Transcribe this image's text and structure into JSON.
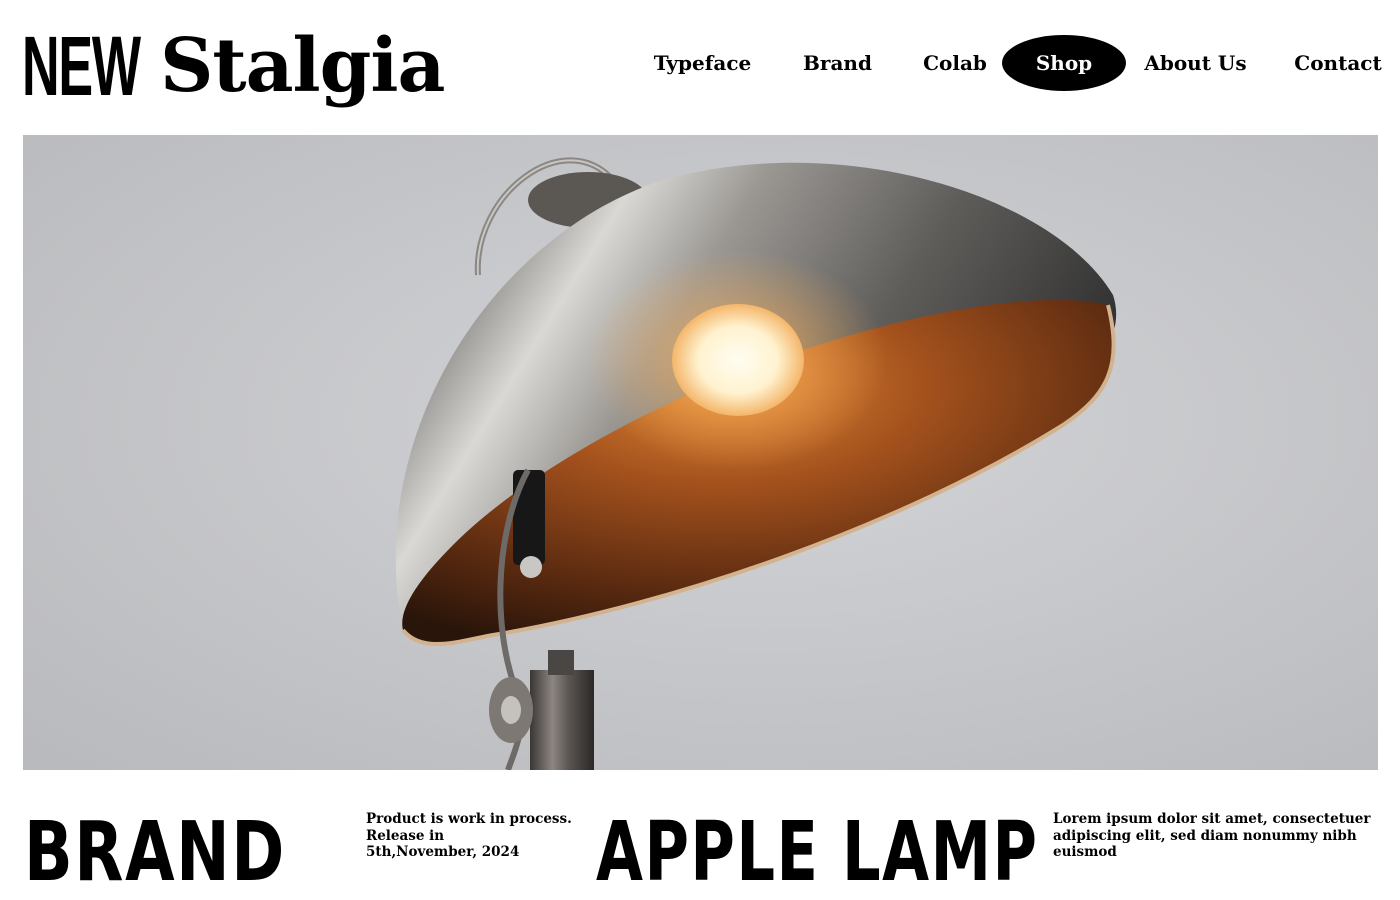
{
  "header": {
    "logo": {
      "part1": "NEW",
      "part2": "Stalgia"
    },
    "nav": [
      {
        "label": "Typeface",
        "active": false
      },
      {
        "label": "Brand",
        "active": false
      },
      {
        "label": "Colab",
        "active": false
      },
      {
        "label": "Shop",
        "active": true
      },
      {
        "label": "About Us",
        "active": false
      },
      {
        "label": "Contact",
        "active": false
      }
    ]
  },
  "hero": {
    "image_subject": "brushed steel desk lamp with glowing bulb"
  },
  "footer": {
    "brand_heading": "BRAND",
    "release_lines": [
      "Product is work in process.",
      "Release in",
      "5th,November, 2024"
    ],
    "product_heading": "APPLE LAMP",
    "description": "Lorem ipsum dolor sit amet, consectetuer adipiscing elit, sed diam nonummy nibh euismod"
  },
  "colors": {
    "accent": "#000000",
    "background": "#ffffff"
  }
}
